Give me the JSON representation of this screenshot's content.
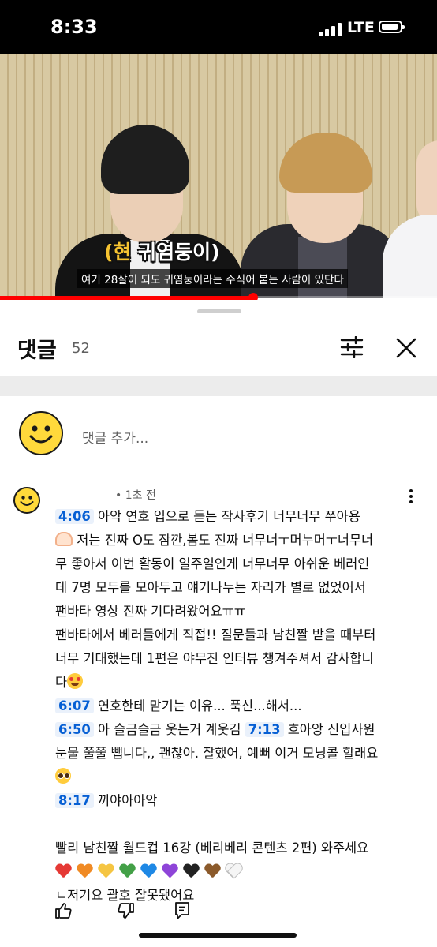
{
  "status_bar": {
    "time": "8:33",
    "network": "LTE"
  },
  "video": {
    "caption_accent": "(현",
    "caption_title": " 귀염둥이)",
    "caption_sub": "여기 28살이 되도 귀염둥이라는 수식어 붙는 사람이 있단다",
    "progress": 0.58
  },
  "comments_panel": {
    "title": "댓글",
    "count": "52",
    "add_placeholder": "댓글 추가..."
  },
  "comment": {
    "time": "• 1초 전",
    "lines": [
      {
        "ts": "4:06",
        "text": " 아악 연호 입으로 듣는 작사후기 너무너무 쭈아용"
      },
      {
        "text": " 저는 진짜 O도 잠깐,봄도 진짜 너무너ㅜ머누머ㅜ너무너"
      },
      {
        "text": "무 좋아서 이번 활동이 일주일인게 너무너무 아쉬운 베러인"
      },
      {
        "text": "데 7명 모두를 모아두고 얘기나누는 자리가 별로 없었어서"
      },
      {
        "text": "팬바타 영상 진짜 기다려왔어요ㅠㅠ"
      },
      {
        "text": "팬바타에서 베러들에게 직접!! 질문들과 남친짤 받을 때부터"
      },
      {
        "text": "너무 기대했는데 1편은 야무진 인터뷰 챙겨주셔서 감사합니"
      },
      {
        "text": "다"
      },
      {
        "ts": "6:07",
        "text": " 연호한테 맡기는 이유... 푹신...해서..."
      },
      {
        "ts": "6:50",
        "text": " 아 슬금슬금 웃는거 계웃김 ",
        "ts2": "7:13",
        "text2": " 흐아앙 신입사원"
      },
      {
        "text": "눈물 쭐쭐 뺍니다,, 괜찮아. 잘했어, 예뻐 이거 모닝콜 할래요"
      },
      {
        "text": ""
      },
      {
        "ts": "8:17",
        "text": " 끼야아아악"
      },
      {
        "text": ""
      },
      {
        "text": "빨리 남친짤 월드컵 16강 (베리베리 콘텐츠 2편) 와주세요"
      },
      {
        "text": ""
      },
      {
        "text": "ㄴ저기요 괄호 잘못됐어요"
      }
    ],
    "hearts": [
      "#e53935",
      "#f08a24",
      "#f5c542",
      "#43a047",
      "#1e88e5",
      "#8e44d8",
      "#222222",
      "#8b5a2b",
      "#ffffff"
    ]
  },
  "colors": {
    "accent": "#065fd4",
    "progress": "#ff0000",
    "caption_accent": "#f6c331"
  }
}
